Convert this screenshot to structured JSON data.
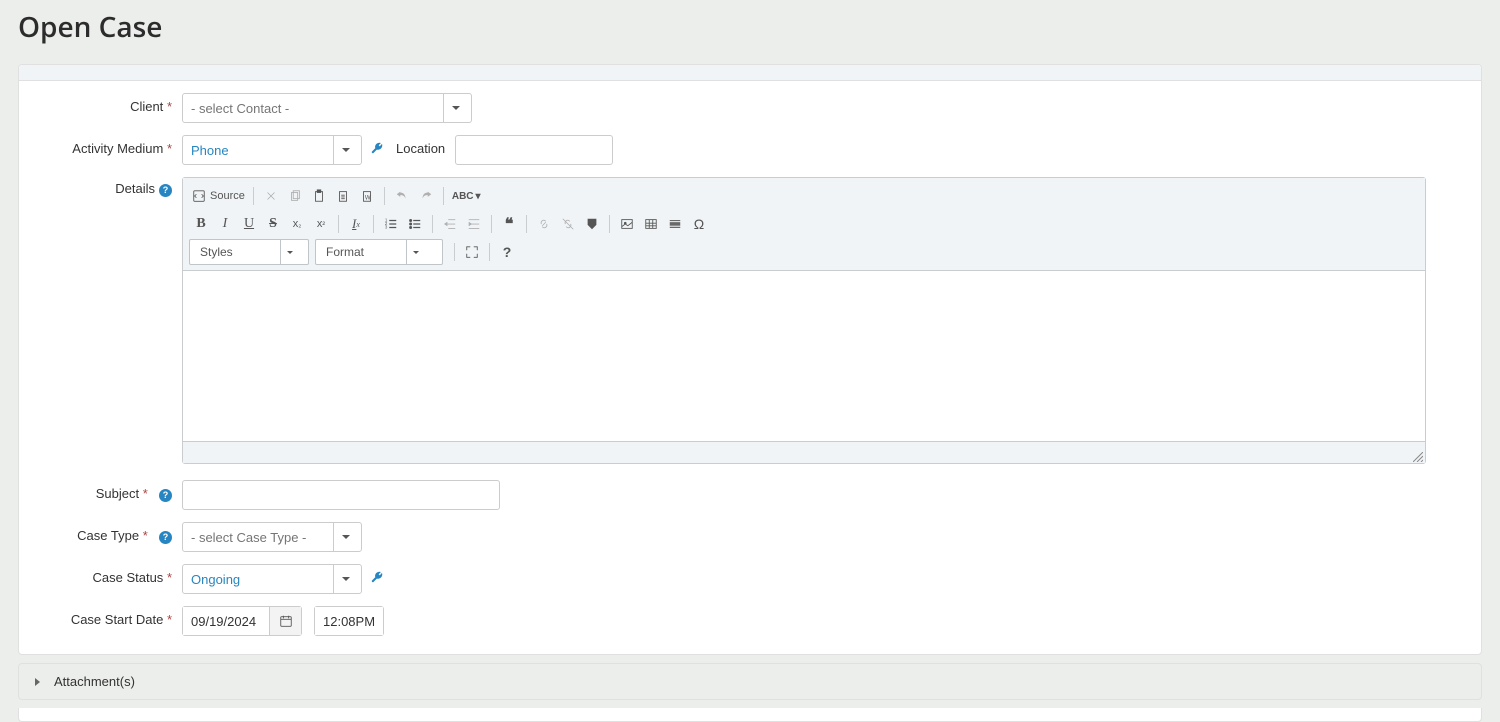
{
  "page_title": "Open Case",
  "labels": {
    "client": "Client",
    "activity_medium": "Activity Medium",
    "location": "Location",
    "details": "Details",
    "subject": "Subject",
    "case_type": "Case Type",
    "case_status": "Case Status",
    "case_start_date": "Case Start Date"
  },
  "fields": {
    "client_placeholder": "- select Contact -",
    "activity_medium_value": "Phone",
    "location_value": "",
    "subject_value": "",
    "case_type_placeholder": "- select Case Type -",
    "case_status_value": "Ongoing",
    "date_value": "09/19/2024",
    "time_value": "12:08PM"
  },
  "editor": {
    "source_label": "Source",
    "styles_label": "Styles",
    "format_label": "Format"
  },
  "accordion": {
    "attachments": "Attachment(s)"
  }
}
